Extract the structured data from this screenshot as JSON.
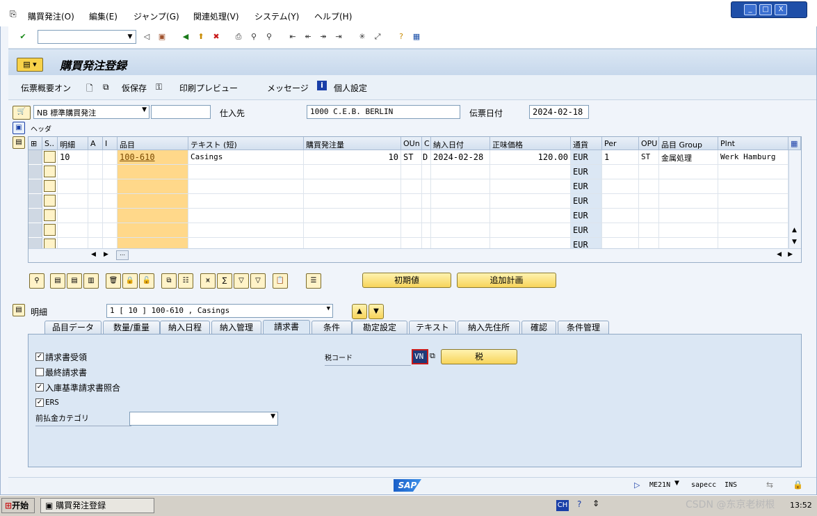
{
  "menu": [
    "購買発注(O)",
    "編集(E)",
    "ジャンプ(G)",
    "関連処理(V)",
    "システム(Y)",
    "ヘルプ(H)"
  ],
  "window_controls": [
    "_",
    "□",
    "X"
  ],
  "title": "購買発注登録",
  "app_toolbar": {
    "doc_overview": "伝票概要オン",
    "hold": "仮保存",
    "print_preview": "印刷プレビュー",
    "messages": "メッセージ",
    "personal_settings": "個人設定"
  },
  "header": {
    "doc_type": "NB 標準購買発注",
    "doc_number": "",
    "vendor_label": "仕入先",
    "vendor_value": "1000 C.E.B. BERLIN",
    "doc_date_label": "伝票日付",
    "doc_date_value": "2024-02-18",
    "header_section": "ヘッダ"
  },
  "table": {
    "columns": [
      "S..",
      "明細",
      "A",
      "I",
      "品目",
      "テキスト (短)",
      "購買発注量",
      "OUn",
      "C",
      "納入日付",
      "正味価格",
      "通貨",
      "Per",
      "OPU",
      "品目 Group",
      "Plnt"
    ],
    "rows": [
      {
        "item": "10",
        "material": "100-610",
        "text": "Casings",
        "qty": "10",
        "oun": "ST",
        "c": "D",
        "delivery": "2024-02-28",
        "price": "120.00",
        "currency": "EUR",
        "per": "1",
        "opu": "ST",
        "group": "金属処理",
        "plant": "Werk Hamburg"
      },
      {
        "currency": "EUR"
      },
      {
        "currency": "EUR"
      },
      {
        "currency": "EUR"
      },
      {
        "currency": "EUR"
      },
      {
        "currency": "EUR"
      },
      {
        "currency": "EUR"
      }
    ]
  },
  "buttons": {
    "default_values": "初期値",
    "additional_planning": "追加計画"
  },
  "item_detail": {
    "label": "明細",
    "selected": "1 [ 10 ] 100-610 , Casings"
  },
  "tabs": [
    "品目データ",
    "数量/重量",
    "納入日程",
    "納入管理",
    "請求書",
    "条件",
    "勘定設定",
    "テキスト",
    "納入先住所",
    "確認",
    "条件管理"
  ],
  "active_tab": "請求書",
  "invoice": {
    "inv_receipt": "請求書受領",
    "inv_receipt_checked": true,
    "final_invoice": "最終請求書",
    "final_invoice_checked": false,
    "gr_based": "入庫基準請求書照合",
    "gr_based_checked": true,
    "ers": "ERS",
    "ers_checked": true,
    "dp_category": "前払金カテゴリ",
    "dp_value": "",
    "tax_code_label": "税コード",
    "tax_code_value": "VN",
    "tax_button": "税"
  },
  "status": {
    "tcode": "ME21N",
    "server": "sapecc",
    "mode": "INS",
    "sap_logo": "SAP"
  },
  "taskbar": {
    "start": "开始",
    "task": "購買発注登録",
    "lang": "CH",
    "watermark": "CSDN @东京老树根",
    "time": "13:52"
  }
}
